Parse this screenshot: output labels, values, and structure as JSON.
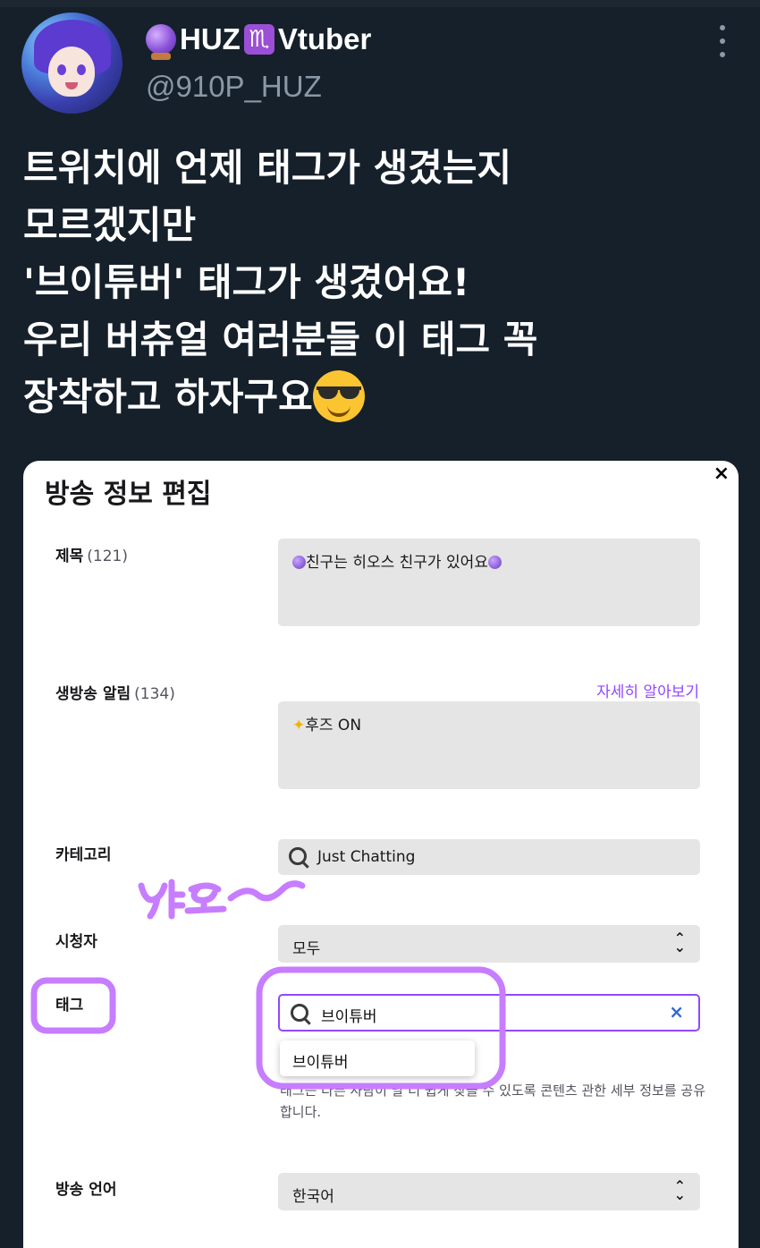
{
  "profile": {
    "display_name": "HUZ",
    "name_suffix": "Vtuber",
    "scorpio_glyph": "♏",
    "handle": "@910P_HUZ",
    "icons": [
      "crystal-ball-icon",
      "scorpio-icon",
      "more-icon"
    ]
  },
  "tweet": {
    "lines": [
      "트위치에 언제 태그가 생겼는지",
      "모르겠지만",
      "'브이튜버' 태그가 생겼어요!",
      "우리 버츄얼 여러분들 이 태그 꼭",
      "장착하고 하자구요"
    ]
  },
  "panel": {
    "title": "방송 정보 편집",
    "close_glyph": "×",
    "title_field": {
      "label": "제목",
      "count": "(121)",
      "value": "친구는 히오스 친구가 있어요"
    },
    "notification": {
      "label": "생방송 알림",
      "count": "(134)",
      "learn_more": "자세히 알아보기",
      "value": "후즈 ON"
    },
    "category": {
      "label": "카테고리",
      "value": "Just Chatting"
    },
    "audience": {
      "label": "시청자",
      "value": "모두"
    },
    "tags": {
      "label": "태그",
      "input_value": "브이튜버",
      "clear_glyph": "×",
      "suggestion": "브이튜버",
      "help": "태그는 다른 사람이 날 더 쉽게 찾을 수 있도록 콘텐츠 관한 세부 정보를 공유합니다."
    },
    "language": {
      "label": "방송 언어",
      "value": "한국어"
    }
  },
  "annotations": {
    "handwritten_text": "야호~",
    "highlight_color": "#c77dff"
  }
}
